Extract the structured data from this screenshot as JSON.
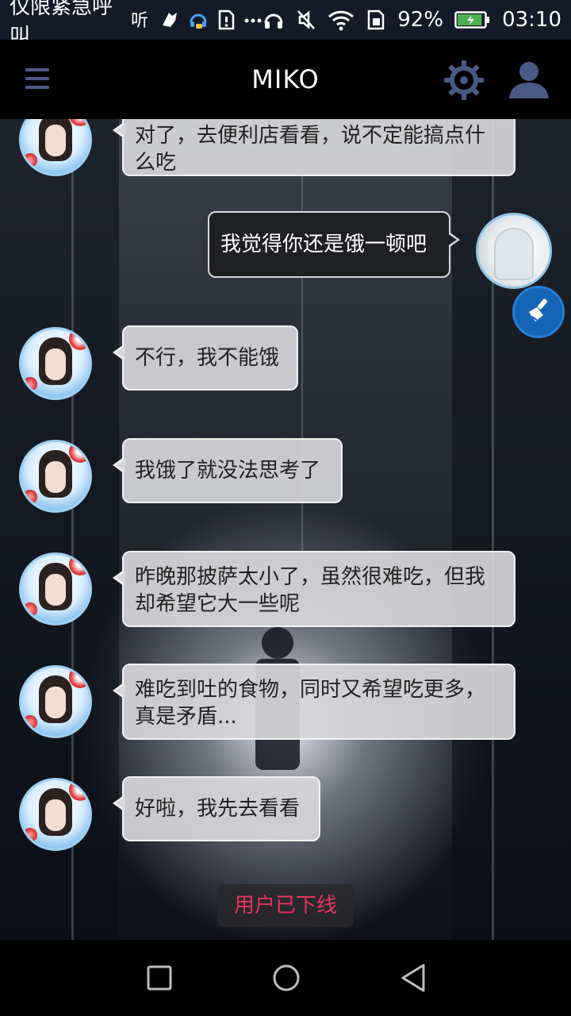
{
  "status_bar": {
    "carrier_text": "仅限紧急呼叫",
    "battery_percent": "92%",
    "time": "03:10",
    "icons": [
      "signal-text-icon",
      "notification-app-icon",
      "headset-app-icon",
      "sim-warning-icon",
      "more-icon",
      "headphones-icon",
      "mute-icon",
      "wifi-icon",
      "sim-card-icon",
      "battery-icon"
    ],
    "battery_color": "#4caf50"
  },
  "app_bar": {
    "title": "MIKO",
    "icons": [
      "menu-icon",
      "gear-icon",
      "user-icon"
    ],
    "accent_color": "#4a5a85"
  },
  "messages": [
    {
      "sender": "bot",
      "text": "对了，去便利店看看，说不定能搞点什么吃"
    },
    {
      "sender": "user",
      "text": "我觉得你还是饿一顿吧"
    },
    {
      "sender": "bot",
      "text": "不行，我不能饿"
    },
    {
      "sender": "bot",
      "text": "我饿了就没法思考了"
    },
    {
      "sender": "bot",
      "text": "昨晚那披萨太小了，虽然很难吃，但我却希望它大一些呢"
    },
    {
      "sender": "bot",
      "text": "难吃到吐的食物，同时又希望吃更多，真是矛盾..."
    },
    {
      "sender": "bot",
      "text": "好啦，我先去看看"
    }
  ],
  "clear_button": {
    "icon": "broom-icon"
  },
  "offline_notice": {
    "text": "用户已下线",
    "color": "#e8335e"
  },
  "nav_bar": {
    "icons": [
      "recent-apps-icon",
      "home-icon",
      "back-icon"
    ]
  }
}
